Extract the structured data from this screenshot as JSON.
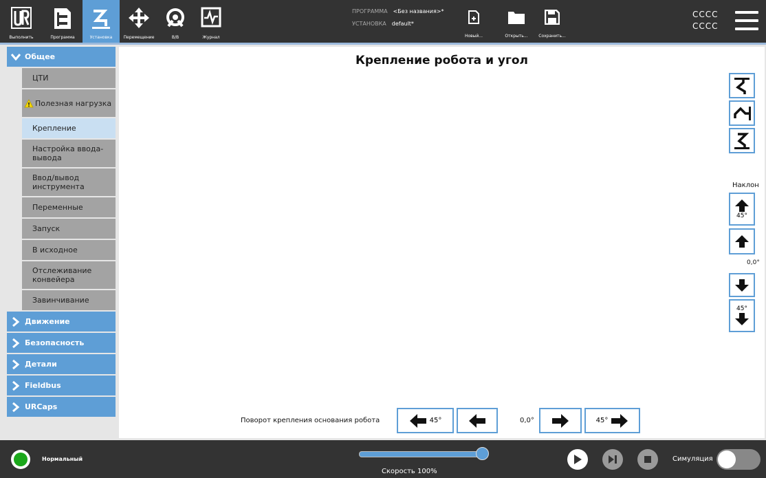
{
  "topbar": {
    "tools": [
      {
        "label": "Выполнить",
        "icon": "ur-logo-icon"
      },
      {
        "label": "Программа",
        "icon": "program-icon"
      },
      {
        "label": "Установка",
        "icon": "installation-robot-icon"
      },
      {
        "label": "Перемещение",
        "icon": "move-arrows-icon"
      },
      {
        "label": "В/В",
        "icon": "io-icon"
      },
      {
        "label": "Журнал",
        "icon": "log-pulse-icon"
      }
    ],
    "program_label": "ПРОГРАММА",
    "program_value": "<Без названия>*",
    "installation_label": "УСТАНОВКА",
    "installation_value": "default*",
    "file_buttons": [
      {
        "label": "Новый...",
        "icon": "new-file-icon"
      },
      {
        "label": "Открыть...",
        "icon": "folder-icon"
      },
      {
        "label": "Сохранить...",
        "icon": "save-disk-icon"
      }
    ],
    "user_line1": "CCCC",
    "user_line2": "CCCC"
  },
  "sidebar": {
    "sections": [
      {
        "label": "Общее",
        "expanded": true
      },
      {
        "label": "Движение"
      },
      {
        "label": "Безопасность"
      },
      {
        "label": "Детали"
      },
      {
        "label": "Fieldbus"
      },
      {
        "label": "URCaps"
      }
    ],
    "items": [
      {
        "label": "ЦТИ"
      },
      {
        "label": "Полезная нагрузка",
        "warning": true
      },
      {
        "label": "Крепление",
        "selected": true
      },
      {
        "label": "Настройка ввода-вывода"
      },
      {
        "label": "Ввод/вывод инструмента"
      },
      {
        "label": "Переменные"
      },
      {
        "label": "Запуск"
      },
      {
        "label": "В исходное"
      },
      {
        "label": "Отслеживание конвейера"
      },
      {
        "label": "Завинчивание"
      }
    ]
  },
  "main": {
    "title": "Крепление робота и угол",
    "tilt_label": "Наклон",
    "tilt_up_45": "45°",
    "tilt_value": "0,0°",
    "tilt_down_45": "45°",
    "rotation_label": "Поворот крепления основания робота",
    "rot_left_45": "45°",
    "rotation_value": "0,0°",
    "rot_right_45": "45°"
  },
  "bottombar": {
    "status": "Нормальный",
    "status_color": "#1aa71a",
    "speed_text": "Скорость 100%",
    "speed_percent": 100,
    "simulation_label": "Симуляция",
    "simulation_on": false
  },
  "colors": {
    "accent": "#5e9ed6",
    "topbar": "#333333",
    "selected": "#c9dff2"
  }
}
